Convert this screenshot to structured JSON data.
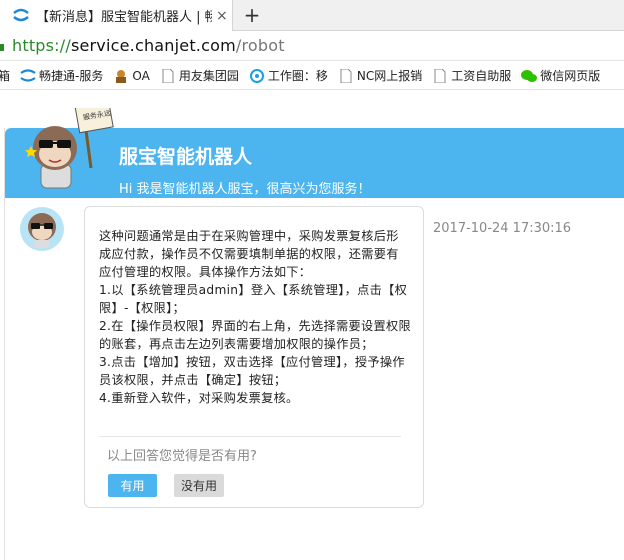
{
  "browser": {
    "tab_title": "【新消息】服宝智能机器人 | 畅",
    "tab_close": "×",
    "new_tab": "+",
    "url_scheme": "https://",
    "url_host": "service.chanjet.com",
    "url_path": "/robot"
  },
  "bookmarks": [
    {
      "label": "邮箱",
      "icon": "mail-icon"
    },
    {
      "label": "畅捷通-服务",
      "icon": "chanjet-icon"
    },
    {
      "label": "OA",
      "icon": "oa-icon"
    },
    {
      "label": "用友集团园",
      "icon": "page-icon"
    },
    {
      "label": "工作圈：移",
      "icon": "circle-icon"
    },
    {
      "label": "NC网上报销",
      "icon": "page-icon"
    },
    {
      "label": "工资自助服",
      "icon": "page-icon"
    },
    {
      "label": "微信网页版",
      "icon": "wechat-icon"
    }
  ],
  "chat": {
    "bot_name": "服宝智能机器人",
    "greeting": "Hi 我是智能机器人服宝，很高兴为您服务！",
    "mascot_sign": "服务永远",
    "timestamp": "2017-10-24 17:30:16",
    "message_lines": [
      "这种问题通常是由于在采购管理中，采购发票复核后形成应付款，操作员不仅需要填制单据的权限，还需要有应付管理的权限。具体操作方法如下：",
      "1.以【系统管理员admin】登入【系统管理】，点击【权限】-【权限】；",
      "2.在【操作员权限】界面的右上角，先选择需要设置权限的账套，再点击左边列表需要增加权限的操作员；",
      "3.点击【增加】按钮，双击选择【应付管理】，授予操作员该权限，并点击【确定】按钮；",
      "4.重新登入软件，对采购发票复核。"
    ],
    "feedback_question": "以上回答您觉得是否有用?",
    "yes_label": "有用",
    "no_label": "没有用"
  },
  "colors": {
    "accent": "#4cb5ef",
    "url_scheme": "#2a8a2a"
  }
}
